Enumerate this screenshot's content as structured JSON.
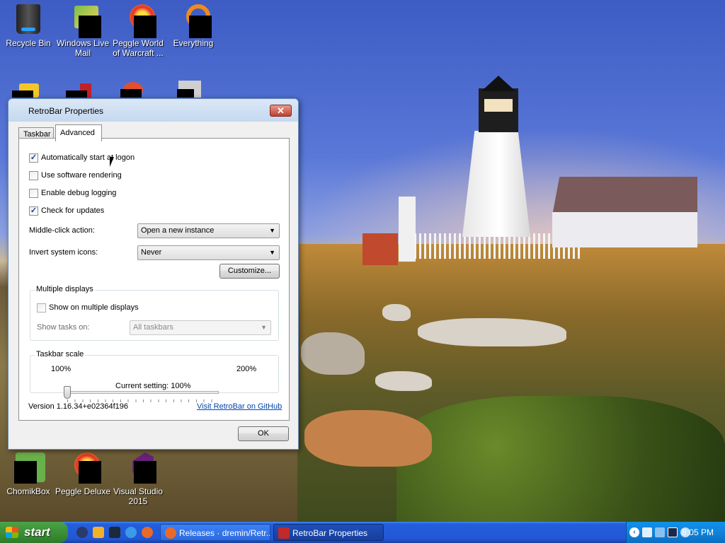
{
  "desktop": {
    "icons": [
      {
        "label": "Recycle Bin"
      },
      {
        "label": "Windows Live Mail"
      },
      {
        "label": "Peggle World of Warcraft ..."
      },
      {
        "label": "Everything"
      },
      {
        "label": "ChomikBox"
      },
      {
        "label": "Peggle Deluxe"
      },
      {
        "label": "Visual Studio 2015"
      }
    ]
  },
  "dialog": {
    "title": "RetroBar Properties",
    "close_glyph": "✕",
    "tabs": [
      {
        "label": "Taskbar",
        "active": false
      },
      {
        "label": "Advanced",
        "active": true
      }
    ],
    "checkboxes": [
      {
        "label": "Automatically start at logon",
        "checked": true
      },
      {
        "label": "Use software rendering",
        "checked": false
      },
      {
        "label": "Enable debug logging",
        "checked": false
      },
      {
        "label": "Check for updates",
        "checked": true
      }
    ],
    "middle_click": {
      "label": "Middle-click action:",
      "value": "Open a new instance"
    },
    "invert_icons": {
      "label": "Invert system icons:",
      "value": "Never"
    },
    "customize_label": "Customize...",
    "multiple_displays": {
      "title": "Multiple displays",
      "show_label": "Show on multiple displays",
      "show_checked": false,
      "tasks_label": "Show tasks on:",
      "tasks_value": "All taskbars"
    },
    "taskbar_scale": {
      "title": "Taskbar scale",
      "min_label": "100%",
      "max_label": "200%",
      "current_label": "Current setting: 100%",
      "value_fraction": 0
    },
    "version": "Version 1.16.34+e02364f196",
    "github_link": "Visit RetroBar on GitHub",
    "ok_label": "OK"
  },
  "taskbar": {
    "start_label": "start",
    "tasks": [
      {
        "label": "Releases · dremin/Retr..."
      },
      {
        "label": "RetroBar Properties"
      }
    ],
    "clock": "8:05 PM"
  },
  "colors": {
    "taskbar_blue": "#245edb",
    "start_green": "#3c8f37",
    "tray_blue": "#0f83d8",
    "link_blue": "#0645ad"
  }
}
